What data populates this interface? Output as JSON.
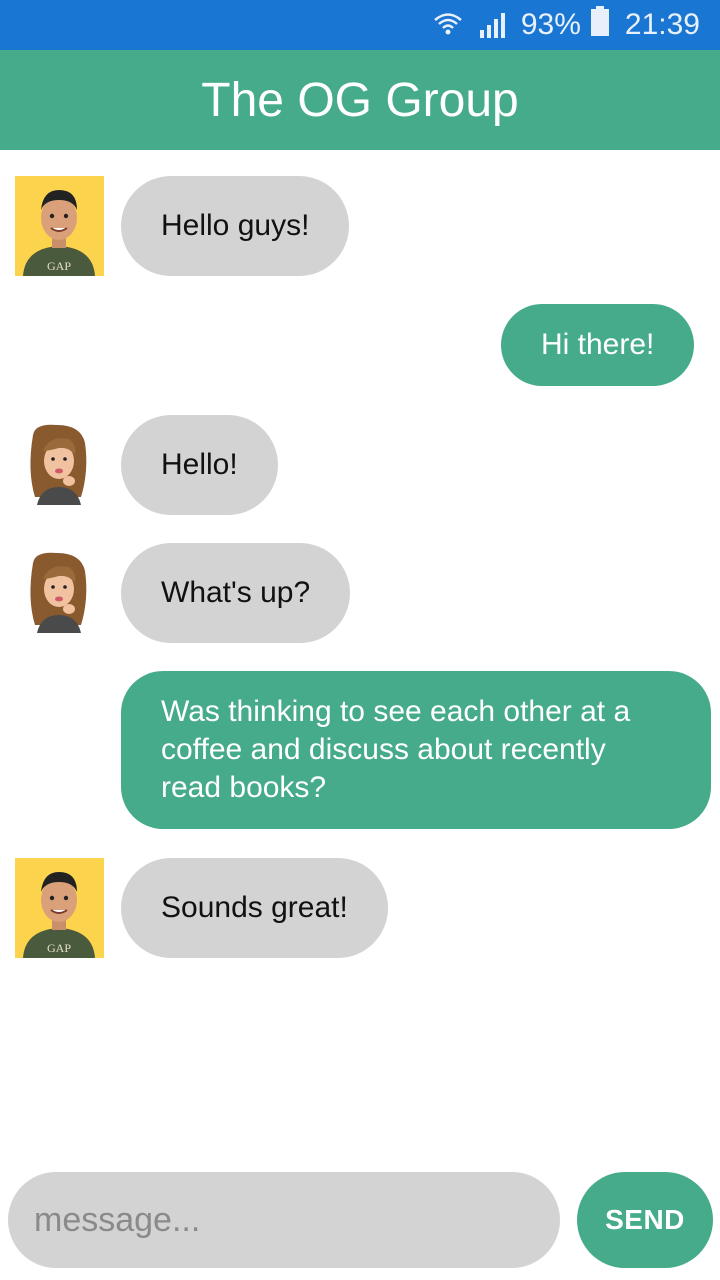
{
  "status_bar": {
    "battery": "93%",
    "time": "21:39",
    "icons": [
      "wifi-icon",
      "signal-icon",
      "battery-icon"
    ]
  },
  "header": {
    "title": "The OG Group"
  },
  "messages": [
    {
      "sender": "male-avatar",
      "direction": "incoming",
      "text": "Hello guys!"
    },
    {
      "direction": "outgoing",
      "text": "Hi there!"
    },
    {
      "sender": "female-avatar",
      "direction": "incoming",
      "text": "Hello!"
    },
    {
      "sender": "female-avatar",
      "direction": "incoming",
      "text": "What's up?"
    },
    {
      "direction": "outgoing",
      "text": "Was thinking to see each other at a coffee and discuss about recently read books?"
    },
    {
      "sender": "male-avatar",
      "direction": "incoming",
      "text": "Sounds great!"
    }
  ],
  "composer": {
    "placeholder": "message...",
    "send_label": "SEND"
  },
  "colors": {
    "status_bar": "#1976d2",
    "accent": "#45ab8a",
    "incoming_bubble": "#d3d3d3"
  }
}
